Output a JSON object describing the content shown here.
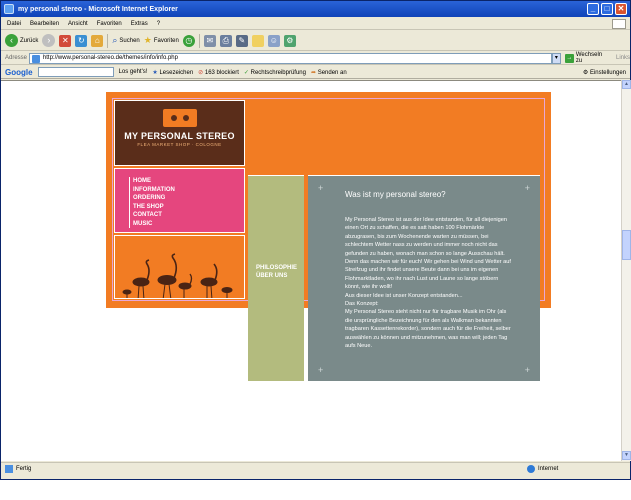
{
  "window": {
    "title": "my personal stereo - Microsoft Internet Explorer",
    "buttons": {
      "minimize": "_",
      "maximize": "□",
      "close": "✕"
    }
  },
  "menu": [
    "Datei",
    "Bearbeiten",
    "Ansicht",
    "Favoriten",
    "Extras",
    "?"
  ],
  "toolbar": {
    "back": "Zurück",
    "search": "Suchen",
    "favorites": "Favoriten"
  },
  "address": {
    "label": "Adresse",
    "url": "http://www.personal-stereo.de/themes/info/info.php",
    "go": "Wechseln zu",
    "links": "Links"
  },
  "googlebar": {
    "logo": "Google",
    "gehts": "Los geht's!",
    "bookmarks": "Lesezeichen",
    "blocked": "163 blockiert",
    "spell": "Rechtschreibprüfung",
    "send": "Senden an",
    "settings": "Einstellungen"
  },
  "status": {
    "text": "Fertig",
    "zone": "Internet"
  },
  "site": {
    "brand": "MY PERSONAL STEREO",
    "tagline": "FLEA MARKET SHOP · COLOGNE",
    "nav": [
      "HOME",
      "INFORMATION",
      "ORDERING",
      "THE SHOP",
      "CONTACT",
      "MUSIC"
    ],
    "subnav": [
      "PHILOSOPHIE",
      "ÜBER UNS"
    ],
    "content": {
      "title": "Was ist my personal stereo?",
      "body": "My Personal Stereo ist aus der Idee entstanden, für all diejenigen einen Ort zu schaffen, die es satt haben 100 Flohmärkte abzugrasen, bis zum Wochenende warten zu müssen, bei schlechtem Wetter nass zu werden und immer noch nicht das gefunden zu haben, wonach man schon so lange Ausschau hält. Denn das machen wir für euch! Wir gehen bei Wind und Wetter auf Streifzug und ihr findet unsere Beute dann bei uns im eigenen Flohmarktladen, wo ihr nach Lust und Laune so lange stöbern könnt, wie ihr wollt!",
      "body2": "Aus dieser Idee ist unser Konzept entstanden...",
      "body3": "Das Konzept:",
      "body4": "My Personal Stereo steht nicht nur für tragbare Musik im Ohr (als die ursprüngliche Bezeichnung für den als Walkman bekannten tragbaren Kassettenrekorder), sondern auch für die Freiheit, selber auswählen zu können und mitzunehmen, was man will; jeden Tag aufs Neue."
    }
  },
  "colors": {
    "orange": "#f27c23",
    "brown": "#5a2d1a",
    "pink": "#e5467e",
    "olive": "#b3bb7e",
    "slate": "#7a8a8a"
  }
}
